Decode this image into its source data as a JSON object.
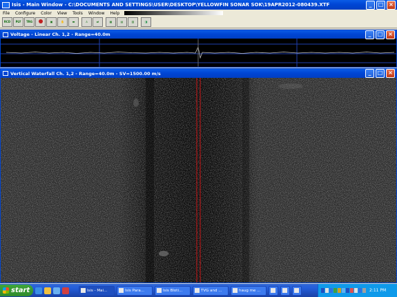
{
  "window": {
    "title": "Isis - Main Window - C:\\DOCUMENTS AND SETTINGS\\USER\\DESKTOP\\YELLOWFIN SONAR SOK\\19APR2012-080439.XTF",
    "controls": {
      "minimize": "_",
      "maximize": "□",
      "close": "×"
    }
  },
  "menu": [
    "File",
    "Configure",
    "Color",
    "View",
    "Tools",
    "Window",
    "Help"
  ],
  "toolbar": {
    "buttons": [
      {
        "label": "RCD",
        "icon": "record-icon"
      },
      {
        "label": "PLY",
        "icon": "play-icon"
      },
      {
        "label": "TRG",
        "icon": "trigger-icon"
      },
      {
        "label": "",
        "icon": "stop-icon"
      },
      {
        "label": "",
        "icon": "save-icon"
      },
      {
        "label": "",
        "icon": "pan-icon"
      },
      {
        "label": "",
        "icon": "tape-icon"
      },
      {
        "label": "",
        "icon": "person-icon"
      },
      {
        "label": "",
        "icon": "transfer-icon"
      },
      {
        "label": "",
        "icon": "grid-icon"
      },
      {
        "label": "",
        "icon": "layers-icon"
      },
      {
        "label": "",
        "icon": "panel-icon"
      },
      {
        "label": "",
        "icon": "monitor-icon"
      }
    ]
  },
  "voltage_panel": {
    "title": "Voltage - Linear Ch. 1,2 - Range=40.0m"
  },
  "waterfall_panel": {
    "title": "Vertical Waterfall Ch. 1,2 - Range=40.0m - SV=1500.00 m/s"
  },
  "taskbar": {
    "start_label": "start",
    "tasks": [
      "Isis - Mai...",
      "Isis Para...",
      "Isis Bloti...",
      "TVG and ...",
      "haug me ...",
      "",
      "",
      ""
    ],
    "clock": "2:11 PM"
  }
}
